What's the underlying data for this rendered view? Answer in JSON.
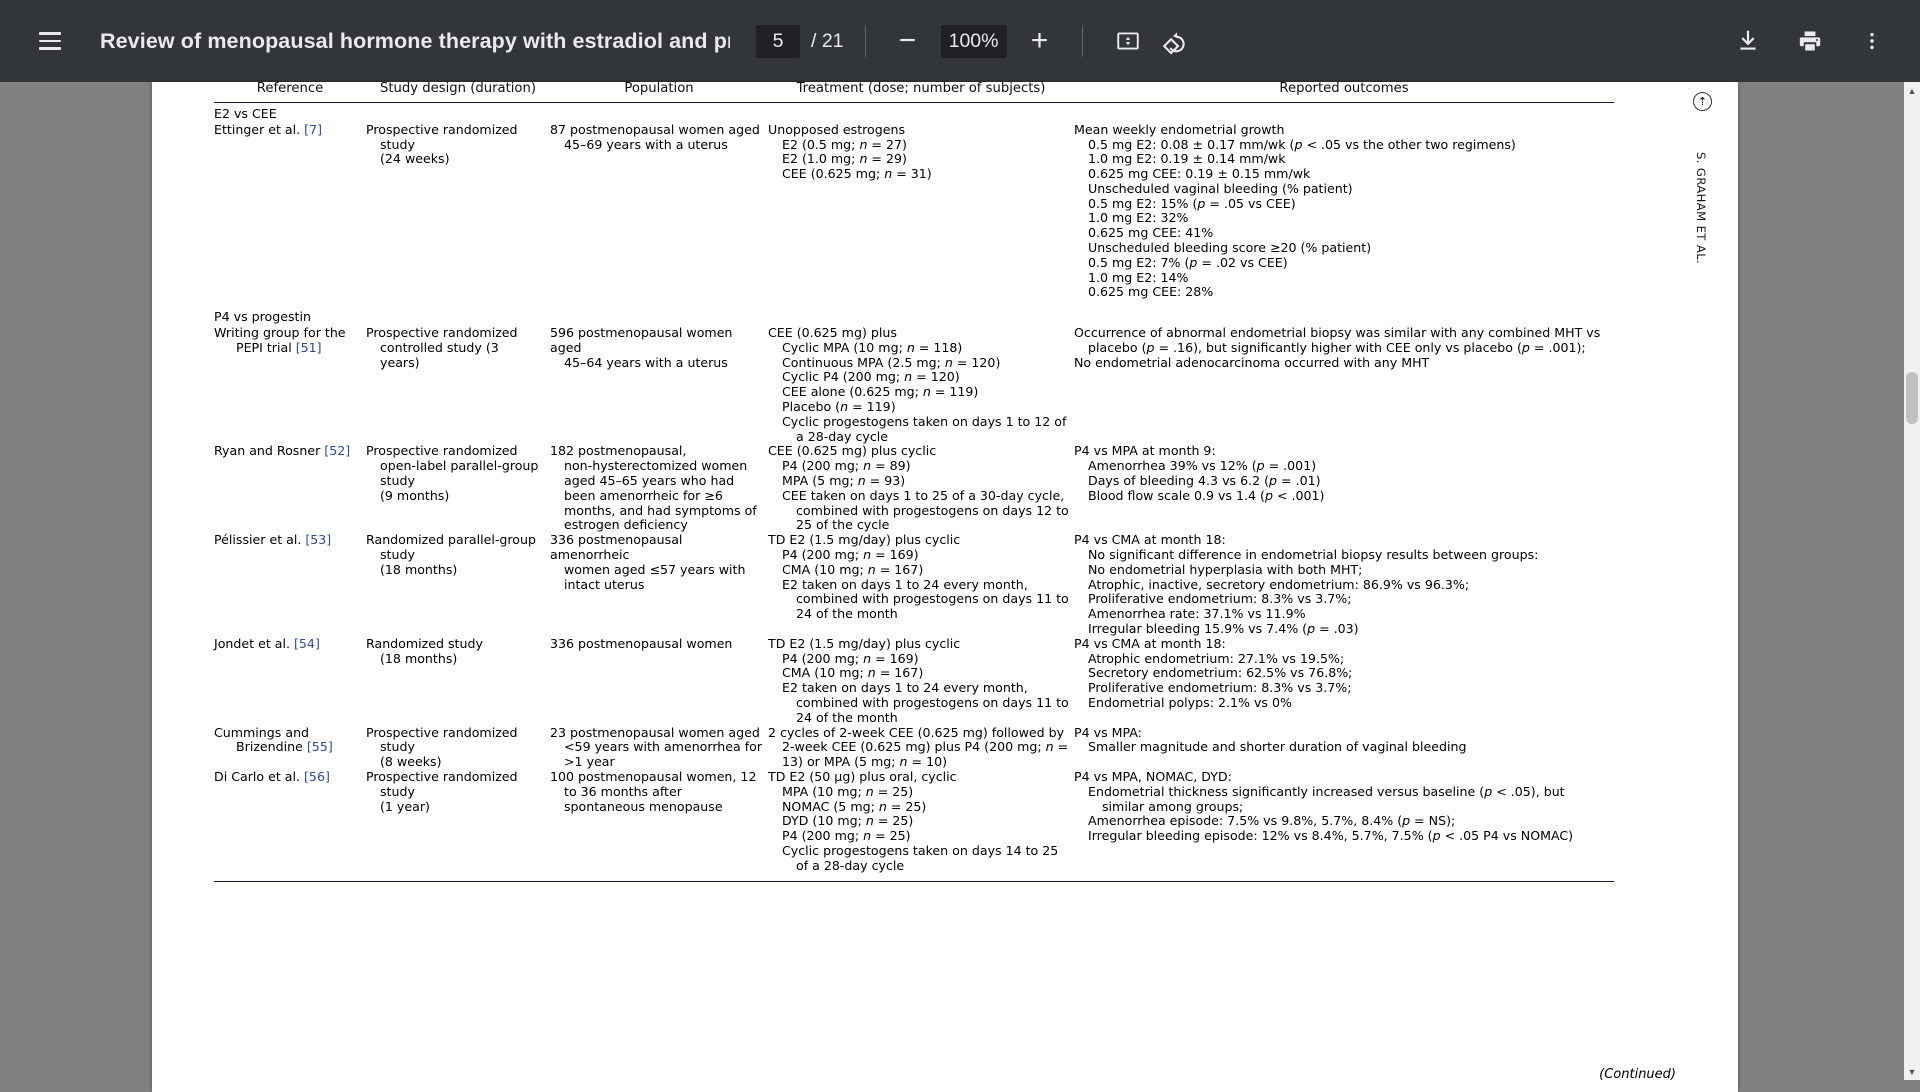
{
  "toolbar": {
    "menu_icon": "hamburger-menu-icon",
    "title": "Review of menopausal hormone therapy with estradiol and prog…",
    "page_current": "5",
    "page_total": "/ 21",
    "zoom_out_label": "−",
    "zoom_value": "100%",
    "zoom_in_label": "+",
    "fit_icon": "fit-to-page-icon",
    "rotate_icon": "rotate-counterclockwise-icon",
    "download_icon": "download-icon",
    "print_icon": "print-icon",
    "more_icon": "more-options-icon",
    "bg_color": "#323639",
    "field_bg": "#202124",
    "text_color": "#e8eaed"
  },
  "scrollbar": {
    "up_arrow": "▲",
    "down_arrow": "▼"
  },
  "document": {
    "side_running_head": "S. GRAHAM ET AL.",
    "side_badge": "⇡",
    "continued_note": "(Continued)",
    "columns": [
      "Reference",
      "Study design (duration)",
      "Population",
      "Treatment (dose; number of subjects)",
      "Reported outcomes"
    ],
    "sections": [
      {
        "label": "E2 vs CEE"
      },
      {
        "label": "P4 vs progestin"
      }
    ],
    "rows": [
      {
        "section": "E2 vs CEE",
        "reference": "Ettinger et al. [7]",
        "design": [
          "Prospective randomized",
          "study",
          "(24 weeks)"
        ],
        "population": [
          "87 postmenopausal women aged",
          "45–69 years with a uterus"
        ],
        "treatment_head": "Unopposed estrogens",
        "treatment_items": [
          "E2 (0.5 mg; n = 27)",
          "E2 (1.0 mg; n = 29)",
          "CEE (0.625 mg; n = 31)"
        ],
        "outcomes": [
          {
            "type": "head",
            "text": "Mean weekly endometrial growth"
          },
          {
            "type": "item",
            "text": "0.5 mg E2: 0.08 ± 0.17 mm/wk (p < .05 vs the other two regimens)"
          },
          {
            "type": "item",
            "text": "1.0 mg E2: 0.19 ± 0.14 mm/wk"
          },
          {
            "type": "item",
            "text": "0.625 mg CEE: 0.19 ± 0.15 mm/wk"
          },
          {
            "type": "item",
            "text": "Unscheduled vaginal bleeding (% patient)"
          },
          {
            "type": "item",
            "text": "0.5 mg E2: 15% (p = .05 vs CEE)"
          },
          {
            "type": "item",
            "text": "1.0 mg E2: 32%"
          },
          {
            "type": "item",
            "text": "0.625 mg CEE: 41%"
          },
          {
            "type": "item",
            "text": "Unscheduled bleeding score ≥20 (% patient)"
          },
          {
            "type": "item",
            "text": "0.5 mg E2: 7% (p = .02 vs CEE)"
          },
          {
            "type": "item",
            "text": "1.0 mg E2: 14%"
          },
          {
            "type": "item",
            "text": "0.625 mg CEE: 28%"
          }
        ]
      },
      {
        "section": "P4 vs progestin",
        "reference": "Writing group for the PEPI trial [51]",
        "design": [
          "Prospective randomized",
          "controlled study (3",
          "years)"
        ],
        "population": [
          "596 postmenopausal women aged",
          "45–64 years with a uterus"
        ],
        "treatment_head": "CEE (0.625 mg) plus",
        "treatment_items": [
          "Cyclic MPA (10 mg; n = 118)",
          "Continuous MPA (2.5 mg; n = 120)",
          "Cyclic P4 (200 mg; n = 120)",
          "CEE alone (0.625 mg; n = 119)",
          "Placebo (n = 119)",
          "Cyclic progestogens taken on days 1 to 12 of a 28-day cycle"
        ],
        "outcomes": [
          {
            "type": "head",
            "text": "Occurrence of abnormal endometrial biopsy was similar with any combined MHT vs placebo (p = .16), but significantly higher with CEE only vs placebo (p = .001);"
          },
          {
            "type": "head",
            "text": "No endometrial adenocarcinoma occurred with any MHT"
          }
        ]
      },
      {
        "section": "",
        "reference": "Ryan and Rosner [52]",
        "design": [
          "Prospective randomized",
          "open-label parallel-group",
          "study",
          "(9 months)"
        ],
        "population": [
          "182 postmenopausal,",
          "non-hysterectomized women",
          "aged 45–65 years who had",
          "been amenorrheic for ≥6",
          "months, and had symptoms of",
          "estrogen deficiency"
        ],
        "treatment_head": "CEE (0.625 mg) plus cyclic",
        "treatment_items": [
          "P4 (200 mg; n = 89)",
          "MPA (5 mg; n = 93)",
          "CEE taken on days 1 to 25 of a 30-day cycle, combined with progestogens on days 12 to 25 of the cycle"
        ],
        "outcomes": [
          {
            "type": "head",
            "text": "P4 vs MPA at month 9:"
          },
          {
            "type": "item",
            "text": "Amenorrhea 39% vs 12% (p = .001)"
          },
          {
            "type": "item",
            "text": "Days of bleeding 4.3 vs 6.2 (p = .01)"
          },
          {
            "type": "item",
            "text": "Blood flow scale 0.9 vs 1.4 (p < .001)"
          }
        ]
      },
      {
        "section": "",
        "reference": "Pélissier et al. [53]",
        "design": [
          "Randomized parallel-group",
          "study",
          "(18 months)"
        ],
        "population": [
          "336 postmenopausal amenorrheic",
          "women aged ≤57 years with",
          "intact uterus"
        ],
        "treatment_head": "TD E2 (1.5 mg/day) plus cyclic",
        "treatment_items": [
          "P4 (200 mg; n = 169)",
          "CMA (10 mg; n = 167)",
          "E2 taken on days 1 to 24 every month, combined with progestogens on days 11 to 24 of the month"
        ],
        "outcomes": [
          {
            "type": "head",
            "text": "P4 vs CMA at month 18:"
          },
          {
            "type": "item",
            "text": "No significant difference in endometrial biopsy results between groups:"
          },
          {
            "type": "item",
            "text": "No endometrial hyperplasia with both MHT;"
          },
          {
            "type": "item",
            "text": "Atrophic, inactive, secretory endometrium: 86.9% vs 96.3%;"
          },
          {
            "type": "item",
            "text": "Proliferative endometrium: 8.3% vs 3.7%;"
          },
          {
            "type": "item",
            "text": "Amenorrhea rate: 37.1% vs 11.9%"
          },
          {
            "type": "item",
            "text": "Irregular bleeding 15.9% vs 7.4% (p = .03)"
          }
        ]
      },
      {
        "section": "",
        "reference": "Jondet et al. [54]",
        "design": [
          "Randomized study",
          "(18 months)"
        ],
        "population": [
          "336 postmenopausal women"
        ],
        "treatment_head": "TD E2 (1.5 mg/day) plus cyclic",
        "treatment_items": [
          "P4 (200 mg; n = 169)",
          "CMA (10 mg; n = 167)",
          "E2 taken on days 1 to 24 every month, combined with progestogens on days 11 to 24 of the month"
        ],
        "outcomes": [
          {
            "type": "head",
            "text": "P4 vs CMA at month 18:"
          },
          {
            "type": "item",
            "text": "Atrophic endometrium: 27.1% vs 19.5%;"
          },
          {
            "type": "item",
            "text": "Secretory endometrium: 62.5% vs 76.8%;"
          },
          {
            "type": "item",
            "text": "Proliferative endometrium: 8.3% vs 3.7%;"
          },
          {
            "type": "item",
            "text": "Endometrial polyps: 2.1% vs 0%"
          }
        ]
      },
      {
        "section": "",
        "reference": "Cummings and Brizendine [55]",
        "design": [
          "Prospective randomized",
          "study",
          "(8 weeks)"
        ],
        "population": [
          "23 postmenopausal women aged",
          "<59 years with amenorrhea for",
          ">1 year"
        ],
        "treatment_head": "2 cycles of 2-week CEE (0.625 mg) followed by 2-week CEE (0.625 mg) plus P4 (200 mg; n = 13) or MPA (5 mg; n = 10)",
        "treatment_items": [],
        "outcomes": [
          {
            "type": "head",
            "text": "P4 vs MPA:"
          },
          {
            "type": "item",
            "text": "Smaller magnitude and shorter duration of vaginal bleeding"
          }
        ]
      },
      {
        "section": "",
        "reference": "Di Carlo et al. [56]",
        "design": [
          "Prospective randomized",
          "study",
          "(1 year)"
        ],
        "population": [
          "100 postmenopausal women, 12",
          "to 36 months after",
          "spontaneous menopause"
        ],
        "treatment_head": "TD E2 (50 µg) plus oral, cyclic",
        "treatment_items": [
          "MPA (10 mg; n = 25)",
          "NOMAC (5 mg; n = 25)",
          "DYD (10 mg; n = 25)",
          "P4 (200 mg; n = 25)",
          "Cyclic progestogens taken on days 14 to 25 of a 28-day cycle"
        ],
        "outcomes": [
          {
            "type": "head",
            "text": "P4 vs MPA, NOMAC, DYD:"
          },
          {
            "type": "item",
            "text": "Endometrial thickness significantly increased versus baseline (p < .05), but similar among groups;"
          },
          {
            "type": "item",
            "text": "Amenorrhea episode: 7.5% vs 9.8%, 5.7%, 8.4% (p = NS);"
          },
          {
            "type": "item",
            "text": "Irregular bleeding episode: 12% vs 8.4%, 5.7%, 7.5% (p < .05 P4 vs NOMAC)"
          }
        ]
      }
    ]
  }
}
